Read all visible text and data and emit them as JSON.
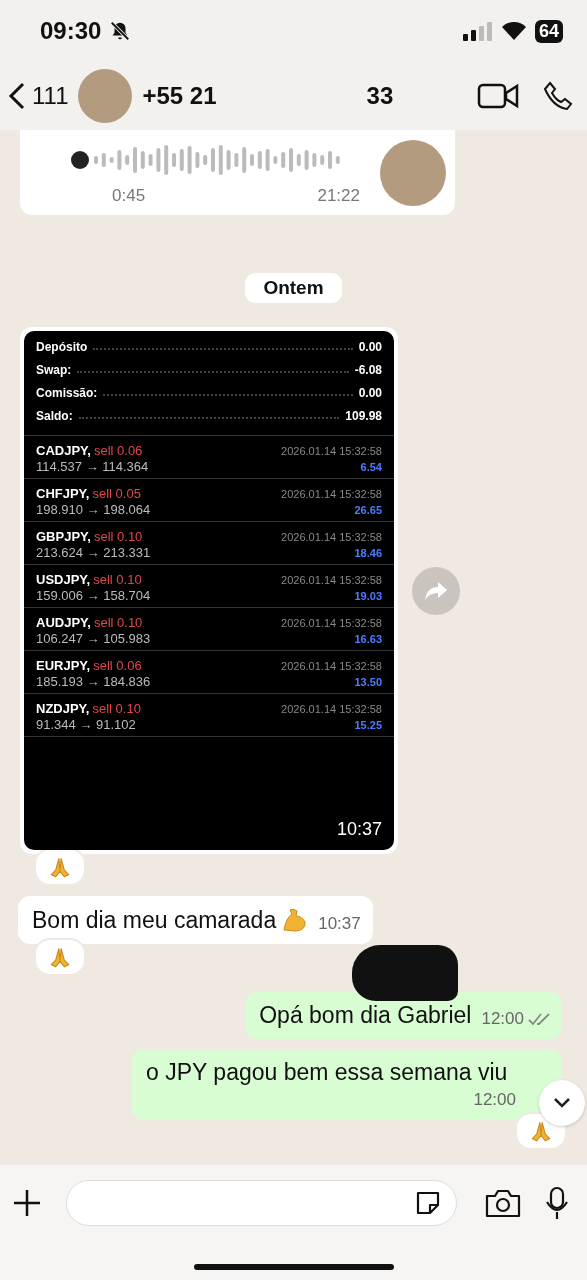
{
  "status_bar": {
    "time": "09:30",
    "silent": true,
    "battery": "64"
  },
  "header": {
    "back_count": "111",
    "contact_name_start": "+55 21",
    "contact_name_end": "33"
  },
  "voice_message": {
    "duration": "0:45",
    "time": "21:22"
  },
  "date_divider": "Ontem",
  "image_message": {
    "summary": [
      {
        "label": "Depósito",
        "value": "0.00"
      },
      {
        "label": "Swap:",
        "value": "-6.08"
      },
      {
        "label": "Comissão:",
        "value": "0.00"
      },
      {
        "label": "Saldo:",
        "value": "109.98"
      }
    ],
    "trades": [
      {
        "symbol": "CADJPY,",
        "order": "sell 0.06",
        "time": "2026.01.14 15:32:58",
        "prices": "114.537 → 114.364",
        "profit": "6.54"
      },
      {
        "symbol": "CHFJPY,",
        "order": "sell 0.05",
        "time": "2026.01.14 15:32:58",
        "prices": "198.910 → 198.064",
        "profit": "26.65"
      },
      {
        "symbol": "GBPJPY,",
        "order": "sell 0.10",
        "time": "2026.01.14 15:32:58",
        "prices": "213.624 → 213.331",
        "profit": "18.46"
      },
      {
        "symbol": "USDJPY,",
        "order": "sell 0.10",
        "time": "2026.01.14 15:32:58",
        "prices": "159.006 → 158.704",
        "profit": "19.03"
      },
      {
        "symbol": "AUDJPY,",
        "order": "sell 0.10",
        "time": "2026.01.14 15:32:58",
        "prices": "106.247 → 105.983",
        "profit": "16.63"
      },
      {
        "symbol": "EURJPY,",
        "order": "sell 0.06",
        "time": "2026.01.14 15:32:58",
        "prices": "185.193 → 184.836",
        "profit": "13.50"
      },
      {
        "symbol": "NZDJPY,",
        "order": "sell 0.10",
        "time": "2026.01.14 15:32:58",
        "prices": "91.344 → 91.102",
        "profit": "15.25"
      }
    ],
    "time": "10:37",
    "reacted": true
  },
  "text_messages": [
    {
      "outgoing": false,
      "text": "Bom dia meu camarada",
      "flex_emoji": true,
      "time": "10:37",
      "reacted": true
    },
    {
      "outgoing": true,
      "text": "Opá bom dia Gabriel",
      "time": "12:00",
      "delivered": true,
      "reacted": false
    },
    {
      "outgoing": true,
      "text": "o JPY pagou bem essa semana viu",
      "time": "12:00",
      "reacted": true
    }
  ]
}
